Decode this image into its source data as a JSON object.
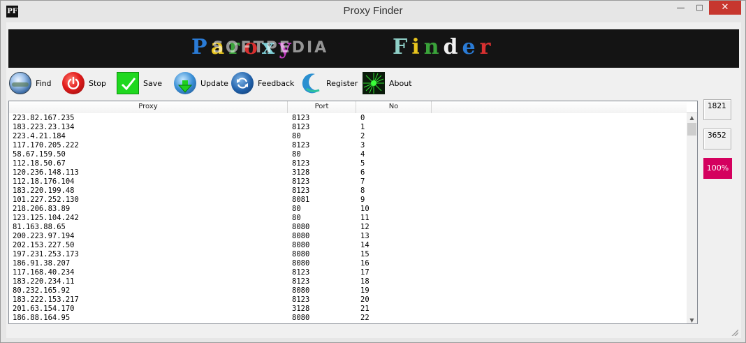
{
  "window": {
    "title": "Proxy Finder",
    "icon_text": "PF",
    "controls": {
      "minimize": "—",
      "maximize": "□",
      "close": "✕"
    }
  },
  "banner": {
    "left_word": [
      "P",
      "a",
      "r",
      "o",
      "x",
      "y"
    ],
    "watermark": "SOFTPEDIA",
    "right_word": [
      "F",
      "i",
      "n",
      "d",
      "e",
      "r"
    ],
    "colors": {
      "background": "#141414",
      "blue": "#2a7bd6",
      "yellow": "#e8c51e",
      "green": "#3aa33a",
      "red": "#d83030"
    }
  },
  "toolbar": {
    "find": "Find",
    "stop": "Stop",
    "save": "Save",
    "update": "Update",
    "feedback": "Feedback",
    "register": "Register",
    "about": "About"
  },
  "list": {
    "columns": {
      "proxy": "Proxy",
      "port": "Port",
      "no": "No"
    },
    "rows": [
      {
        "proxy": "223.82.167.235",
        "port": "8123",
        "no": "0"
      },
      {
        "proxy": "183.223.23.134",
        "port": "8123",
        "no": "1"
      },
      {
        "proxy": "223.4.21.184",
        "port": "80",
        "no": "2"
      },
      {
        "proxy": "117.170.205.222",
        "port": "8123",
        "no": "3"
      },
      {
        "proxy": "58.67.159.50",
        "port": "80",
        "no": "4"
      },
      {
        "proxy": "112.18.50.67",
        "port": "8123",
        "no": "5"
      },
      {
        "proxy": "120.236.148.113",
        "port": "3128",
        "no": "6"
      },
      {
        "proxy": "112.18.176.104",
        "port": "8123",
        "no": "7"
      },
      {
        "proxy": "183.220.199.48",
        "port": "8123",
        "no": "8"
      },
      {
        "proxy": "101.227.252.130",
        "port": "8081",
        "no": "9"
      },
      {
        "proxy": "218.206.83.89",
        "port": "80",
        "no": "10"
      },
      {
        "proxy": "123.125.104.242",
        "port": "80",
        "no": "11"
      },
      {
        "proxy": "81.163.88.65",
        "port": "8080",
        "no": "12"
      },
      {
        "proxy": "200.223.97.194",
        "port": "8080",
        "no": "13"
      },
      {
        "proxy": "202.153.227.50",
        "port": "8080",
        "no": "14"
      },
      {
        "proxy": "197.231.253.173",
        "port": "8080",
        "no": "15"
      },
      {
        "proxy": "186.91.38.207",
        "port": "8080",
        "no": "16"
      },
      {
        "proxy": "117.168.40.234",
        "port": "8123",
        "no": "17"
      },
      {
        "proxy": "183.220.234.11",
        "port": "8123",
        "no": "18"
      },
      {
        "proxy": "80.232.165.92",
        "port": "8080",
        "no": "19"
      },
      {
        "proxy": "183.222.153.217",
        "port": "8123",
        "no": "20"
      },
      {
        "proxy": "201.63.154.170",
        "port": "3128",
        "no": "21"
      },
      {
        "proxy": "186.88.164.95",
        "port": "8080",
        "no": "22"
      }
    ]
  },
  "counters": {
    "found": "1821",
    "checked": "3652",
    "progress": "100%"
  },
  "colors": {
    "progress_bg": "#d4005e",
    "close_button": "#c7372f"
  },
  "icons": {
    "find": "globe-icon",
    "stop": "power-icon",
    "save": "checkmark-icon",
    "update": "download-globe-icon",
    "feedback": "refresh-icon",
    "register": "crescent-icon",
    "about": "burst-icon"
  }
}
